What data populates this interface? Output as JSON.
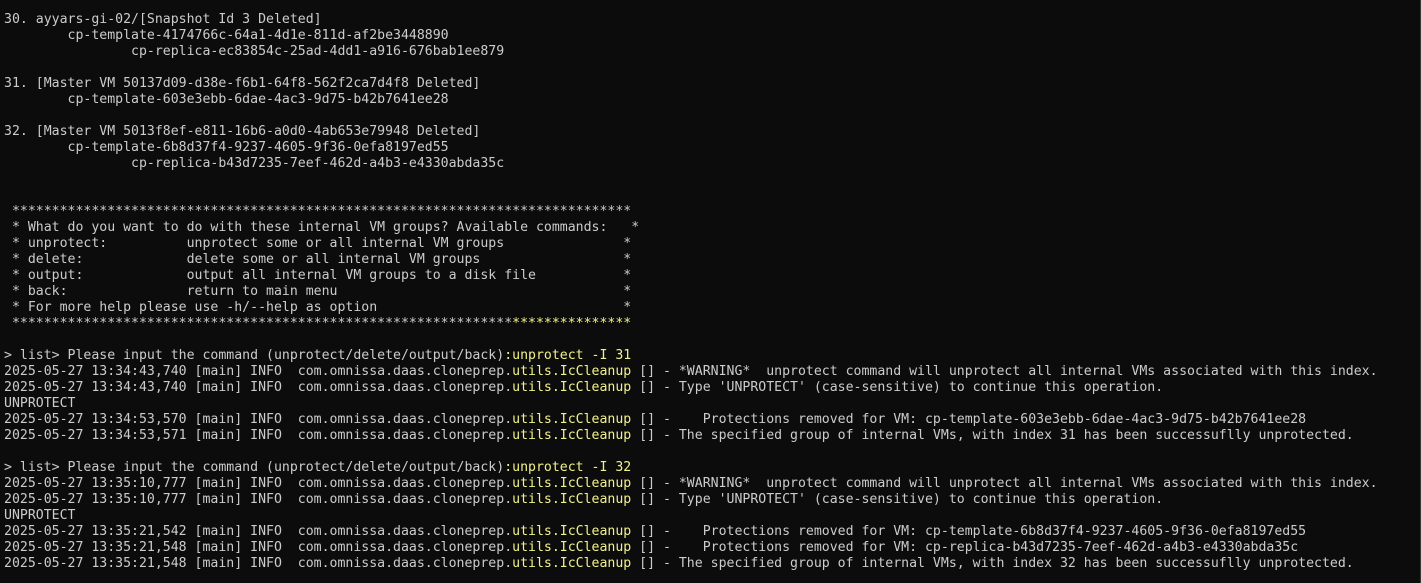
{
  "terminal": {
    "lines": [
      [
        {
          "t": "30. ayyars-gi-02/[Snapshot Id 3 Deleted]"
        }
      ],
      [
        {
          "t": "        cp-template-4174766c-64a1-4d1e-811d-af2be3448890"
        }
      ],
      [
        {
          "t": "                cp-replica-ec83854c-25ad-4dd1-a916-676bab1ee879"
        }
      ],
      [
        {
          "t": ""
        }
      ],
      [
        {
          "t": "31. [Master VM 50137d09-d38e-f6b1-64f8-562f2ca7d4f8 Deleted]"
        }
      ],
      [
        {
          "t": "        cp-template-603e3ebb-6dae-4ac3-9d75-b42b7641ee28"
        }
      ],
      [
        {
          "t": ""
        }
      ],
      [
        {
          "t": "32. [Master VM 5013f8ef-e811-16b6-a0d0-4ab653e79948 Deleted]"
        }
      ],
      [
        {
          "t": "        cp-template-6b8d37f4-9237-4605-9f36-0efa8197ed55"
        }
      ],
      [
        {
          "t": "                cp-replica-b43d7235-7eef-462d-a4b3-e4330abda35c"
        }
      ],
      [
        {
          "t": ""
        }
      ],
      [
        {
          "t": ""
        }
      ],
      [
        {
          "t": " ******************************************************************************"
        }
      ],
      [
        {
          "t": " * What do you want to do with these internal VM groups? Available commands:   *"
        }
      ],
      [
        {
          "t": " * unprotect:          unprotect some or all internal VM groups               *"
        }
      ],
      [
        {
          "t": " * delete:             delete some or all internal VM groups                  *"
        }
      ],
      [
        {
          "t": " * output:             output all internal VM groups to a disk file           *"
        }
      ],
      [
        {
          "t": " * back:               return to main menu                                    *"
        }
      ],
      [
        {
          "t": " * For more help please use -h/--help as option                               *"
        }
      ],
      [
        {
          "t": " ***************************************************************"
        },
        {
          "t": "***************",
          "y": true
        }
      ],
      [
        {
          "t": ""
        }
      ],
      [
        {
          "t": "> list> Please input the command (unprotect/delete/output/back)"
        },
        {
          "t": ":unprotect -I 31",
          "y": true
        }
      ],
      [
        {
          "t": "2025-05-27 13:34:43,740 [main] INFO  com.omnissa.daas.cloneprep."
        },
        {
          "t": "utils.IcCleanup",
          "y": true
        },
        {
          "t": " [] - *WARNING*  unprotect command will unprotect all internal VMs associated with this index."
        }
      ],
      [
        {
          "t": "2025-05-27 13:34:43,740 [main] INFO  com.omnissa.daas.cloneprep."
        },
        {
          "t": "utils.IcCleanup",
          "y": true
        },
        {
          "t": " [] - Type 'UNPROTECT' (case-sensitive) to continue this operation."
        }
      ],
      [
        {
          "t": "UNPROTECT"
        }
      ],
      [
        {
          "t": "2025-05-27 13:34:53,570 [main] INFO  com.omnissa.daas.cloneprep."
        },
        {
          "t": "utils.IcCleanup",
          "y": true
        },
        {
          "t": " [] -    Protections removed for VM: cp-template-603e3ebb-6dae-4ac3-9d75-b42b7641ee28"
        }
      ],
      [
        {
          "t": "2025-05-27 13:34:53,571 [main] INFO  com.omnissa.daas.cloneprep."
        },
        {
          "t": "utils.IcCleanup",
          "y": true
        },
        {
          "t": " [] - The specified group of internal VMs, with index 31 has been successuflly unprotected."
        }
      ],
      [
        {
          "t": ""
        }
      ],
      [
        {
          "t": "> list> Please input the command (unprotect/delete/output/back)"
        },
        {
          "t": ":unprotect -I 32",
          "y": true
        }
      ],
      [
        {
          "t": "2025-05-27 13:35:10,777 [main] INFO  com.omnissa.daas.cloneprep."
        },
        {
          "t": "utils.IcCleanup",
          "y": true
        },
        {
          "t": " [] - *WARNING*  unprotect command will unprotect all internal VMs associated with this index."
        }
      ],
      [
        {
          "t": "2025-05-27 13:35:10,777 [main] INFO  com.omnissa.daas.cloneprep."
        },
        {
          "t": "utils.IcCleanup",
          "y": true
        },
        {
          "t": " [] - Type 'UNPROTECT' (case-sensitive) to continue this operation."
        }
      ],
      [
        {
          "t": "UNPROTECT"
        }
      ],
      [
        {
          "t": "2025-05-27 13:35:21,542 [main] INFO  com.omnissa.daas.cloneprep."
        },
        {
          "t": "utils.IcCleanup",
          "y": true
        },
        {
          "t": " [] -    Protections removed for VM: cp-template-6b8d37f4-9237-4605-9f36-0efa8197ed55"
        }
      ],
      [
        {
          "t": "2025-05-27 13:35:21,548 [main] INFO  com.omnissa.daas.cloneprep."
        },
        {
          "t": "utils.IcCleanup",
          "y": true
        },
        {
          "t": " [] -    Protections removed for VM: cp-replica-b43d7235-7eef-462d-a4b3-e4330abda35c"
        }
      ],
      [
        {
          "t": "2025-05-27 13:35:21,548 [main] INFO  com.omnissa.daas.cloneprep."
        },
        {
          "t": "utils.IcCleanup",
          "y": true
        },
        {
          "t": " [] - The specified group of internal VMs, with index 32 has been successuflly unprotected."
        }
      ]
    ]
  },
  "colors": {
    "background": "#0c0c0c",
    "text": "#cccccc",
    "highlight": "#f2f28a"
  }
}
